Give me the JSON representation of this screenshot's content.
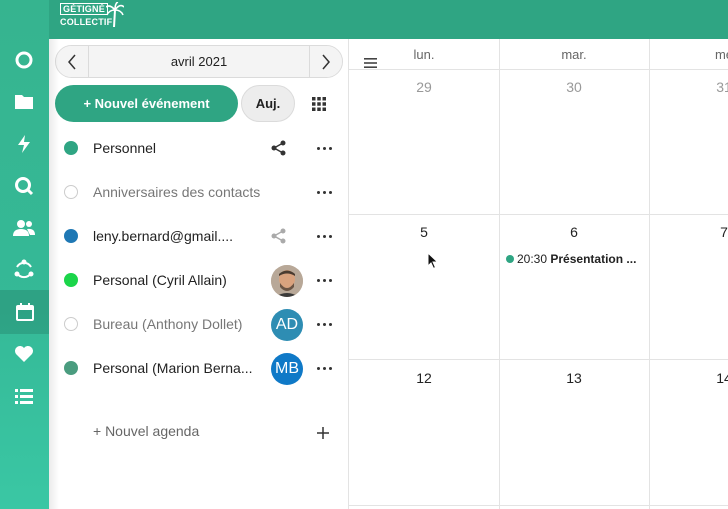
{
  "brand": {
    "line1": "GÉTIGNÉ",
    "line2": "COLLECTIF"
  },
  "rail": {
    "items": [
      {
        "icon": "circle-icon"
      },
      {
        "icon": "folder-icon"
      },
      {
        "icon": "bolt-icon"
      },
      {
        "icon": "search-icon"
      },
      {
        "icon": "contacts-icon"
      },
      {
        "icon": "circles-icon"
      },
      {
        "icon": "calendar-icon",
        "active": true
      },
      {
        "icon": "heart-icon"
      },
      {
        "icon": "list-icon"
      }
    ]
  },
  "sidebar": {
    "month_label": "avril 2021",
    "new_event_label": "+ Nouvel événement",
    "today_label": "Auj.",
    "calendars": [
      {
        "name": "Personnel",
        "color": "#2fa583",
        "enabled": true,
        "shared": true
      },
      {
        "name": "Anniversaires des contacts",
        "color": "",
        "enabled": false
      },
      {
        "name": "leny.bernard@gmail....",
        "color": "#1f78b4",
        "enabled": true,
        "shared_light": true
      },
      {
        "name": "Personal (Cyril Allain)",
        "color": "#1bd54a",
        "enabled": true,
        "avatar": "photo"
      },
      {
        "name": "Bureau (Anthony Dollet)",
        "color": "",
        "enabled": false,
        "avatar_text": "AD",
        "avatar_color": "#2e8db3"
      },
      {
        "name": "Personal (Marion Berna...",
        "color": "#4a9c7f",
        "enabled": true,
        "avatar_text": "MB",
        "avatar_color": "#0f79c7"
      }
    ],
    "new_agenda_label": "+ Nouvel agenda"
  },
  "calendar": {
    "weekdays": [
      "lun.",
      "mar.",
      "me"
    ],
    "weeks": [
      {
        "days": [
          "29",
          "30",
          "31"
        ],
        "other_month": true
      },
      {
        "days": [
          "5",
          "6",
          "7"
        ],
        "other_month": false
      },
      {
        "days": [
          "12",
          "13",
          "14"
        ],
        "other_month": false
      }
    ],
    "event": {
      "time": "20:30",
      "title": "Présentation ..."
    }
  }
}
